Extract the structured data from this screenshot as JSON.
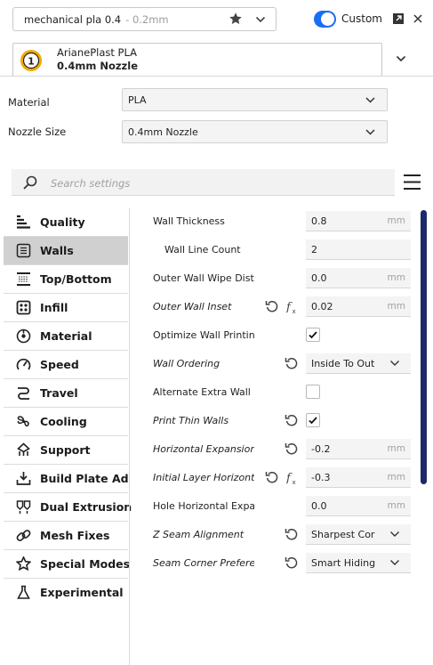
{
  "profile": {
    "name": "mechanical pla 0.4",
    "sub": "- 0.2mm",
    "custom_label": "Custom"
  },
  "extruder": {
    "badge": "1",
    "brand": "ArianePlast PLA",
    "nozzle": "0.4mm Nozzle"
  },
  "material": {
    "label": "Material",
    "value": "PLA"
  },
  "nozzle_size": {
    "label": "Nozzle Size",
    "value": "0.4mm Nozzle"
  },
  "search": {
    "placeholder": "Search settings"
  },
  "categories": [
    {
      "label": "Quality",
      "icon": "quality-icon"
    },
    {
      "label": "Walls",
      "icon": "walls-icon",
      "active": true
    },
    {
      "label": "Top/Bottom",
      "icon": "top-bottom-icon"
    },
    {
      "label": "Infill",
      "icon": "infill-icon"
    },
    {
      "label": "Material",
      "icon": "material-icon"
    },
    {
      "label": "Speed",
      "icon": "speed-icon"
    },
    {
      "label": "Travel",
      "icon": "travel-icon"
    },
    {
      "label": "Cooling",
      "icon": "cooling-icon"
    },
    {
      "label": "Support",
      "icon": "support-icon"
    },
    {
      "label": "Build Plate Adh",
      "icon": "build-plate-icon"
    },
    {
      "label": "Dual Extrusion",
      "icon": "dual-extrusion-icon"
    },
    {
      "label": "Mesh Fixes",
      "icon": "mesh-fixes-icon"
    },
    {
      "label": "Special Modes",
      "icon": "special-modes-icon"
    },
    {
      "label": "Experimental",
      "icon": "experimental-icon"
    }
  ],
  "settings": [
    {
      "label": "Wall Thickness",
      "value": "0.8",
      "unit": "mm"
    },
    {
      "label": "Wall Line Count",
      "value": "2",
      "unit": ""
    },
    {
      "label": "Outer Wall Wipe Dista",
      "value": "0.0",
      "unit": "mm"
    },
    {
      "label": "Outer Wall Inset",
      "value": "0.02",
      "unit": "mm"
    },
    {
      "label": "Optimize Wall Printing",
      "checked": true
    },
    {
      "label": "Wall Ordering",
      "value": "Inside To Out"
    },
    {
      "label": "Alternate Extra Wall",
      "checked": false
    },
    {
      "label": "Print Thin Walls",
      "checked": true
    },
    {
      "label": "Horizontal Expansion",
      "value": "-0.2",
      "unit": "mm"
    },
    {
      "label": "Initial Layer Horizontal",
      "value": "-0.3",
      "unit": "mm"
    },
    {
      "label": "Hole Horizontal Expar",
      "value": "0.0",
      "unit": "mm"
    },
    {
      "label": "Z Seam Alignment",
      "value": "Sharpest Corner"
    },
    {
      "label": "Seam Corner Preference",
      "value": "Smart Hiding"
    }
  ],
  "colors": {
    "accent": "#1a6ef2",
    "badge": "#f2a900",
    "scrollbar": "#1c2a6a",
    "active_category": "#d0d0d0"
  }
}
